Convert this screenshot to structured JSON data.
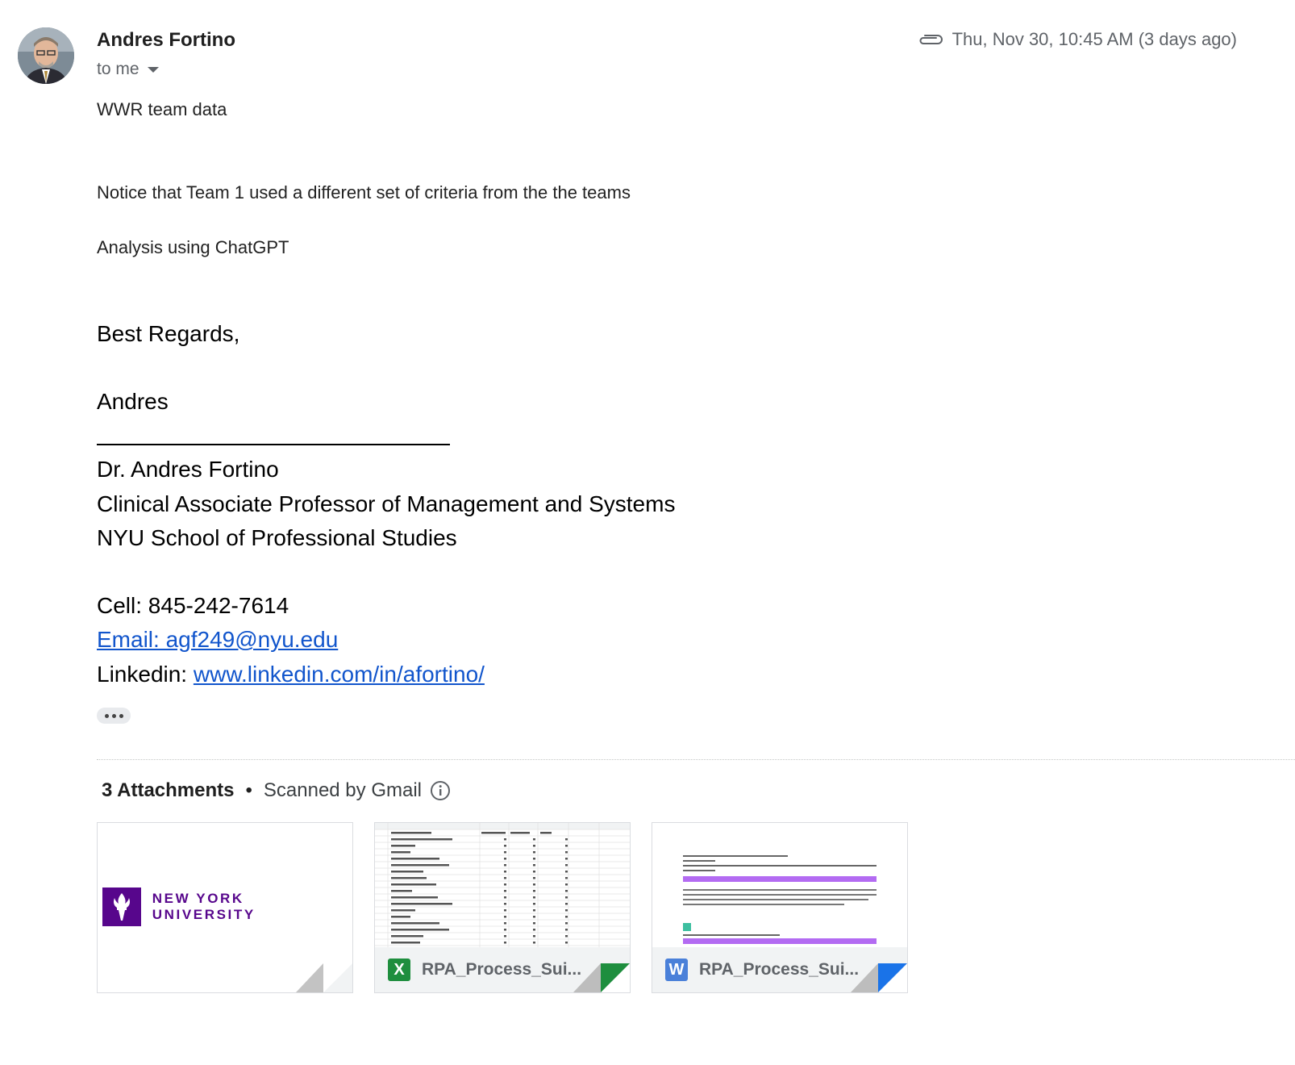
{
  "header": {
    "sender_name": "Andres Fortino",
    "to_label": "to me",
    "date": "Thu, Nov 30, 10:45 AM (3 days ago)"
  },
  "body": {
    "line1": "WWR team data",
    "line2": "Notice that Team 1 used a different set of criteria from the the teams",
    "line3": "Analysis using ChatGPT"
  },
  "signature": {
    "closing": "Best Regards,",
    "first_name": "Andres",
    "full_name": "Dr. Andres Fortino",
    "title": "Clinical Associate Professor of Management and Systems",
    "school": "NYU School of Professional Studies",
    "cell": "Cell: 845-242-7614",
    "email": "Email: agf249@nyu.edu",
    "linkedin_label": "Linkedin: ",
    "linkedin_url": "www.linkedin.com/in/afortino/"
  },
  "attachments": {
    "count_label": "3 Attachments",
    "separator": "•",
    "scanned_label": "Scanned by Gmail",
    "items": [
      {
        "type": "image",
        "logo_text": "NEW YORK UNIVERSITY"
      },
      {
        "type": "sheet",
        "name": "RPA_Process_Sui...",
        "icon_letter": "X",
        "icon_color": "#1e8e3e",
        "fold_color": "#1e8e3e"
      },
      {
        "type": "doc",
        "name": "RPA_Process_Sui...",
        "icon_letter": "W",
        "icon_color": "#4a80d9",
        "fold_color": "#1a73e8"
      }
    ]
  },
  "colors": {
    "link": "#1155cc",
    "nyu_purple": "#57068c"
  }
}
